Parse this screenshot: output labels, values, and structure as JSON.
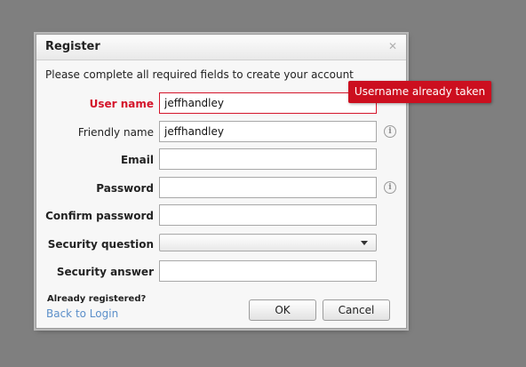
{
  "dialog": {
    "title": "Register",
    "close_icon": "close-icon",
    "subtitle": "Please complete all required fields to create your account"
  },
  "form": {
    "username": {
      "label": "User name",
      "value": "jeffhandley",
      "error": "Username already taken"
    },
    "friendly_name": {
      "label": "Friendly name",
      "value": "jeffhandley",
      "icon": "info-icon"
    },
    "email": {
      "label": "Email",
      "value": ""
    },
    "password": {
      "label": "Password",
      "value": "",
      "icon": "info-icon"
    },
    "confirm_password": {
      "label": "Confirm password",
      "value": ""
    },
    "security_question": {
      "label": "Security question",
      "value": ""
    },
    "security_answer": {
      "label": "Security answer",
      "value": ""
    }
  },
  "footer": {
    "already_registered": "Already registered?",
    "back_link": "Back to Login",
    "ok_label": "OK",
    "cancel_label": "Cancel"
  },
  "colors": {
    "background": "#7f7f7f",
    "error": "#d4142a",
    "tooltip": "#cc0f1f",
    "link": "#5b8fc9"
  }
}
